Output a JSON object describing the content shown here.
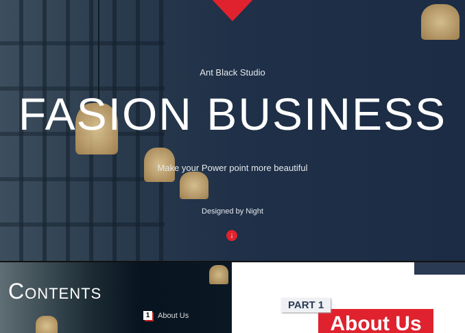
{
  "hero": {
    "studio": "Ant Black Studio",
    "title": "FASION BUSINESS",
    "subtitle": "Make your Power point more beautiful",
    "designer": "Designed by Night",
    "accent": "#e0222e"
  },
  "contents": {
    "title_initial": "C",
    "title_rest": "ONTENTS",
    "items": [
      {
        "number": "1",
        "label": "About Us"
      }
    ]
  },
  "part": {
    "label": "PART 1",
    "title": "About Us"
  }
}
